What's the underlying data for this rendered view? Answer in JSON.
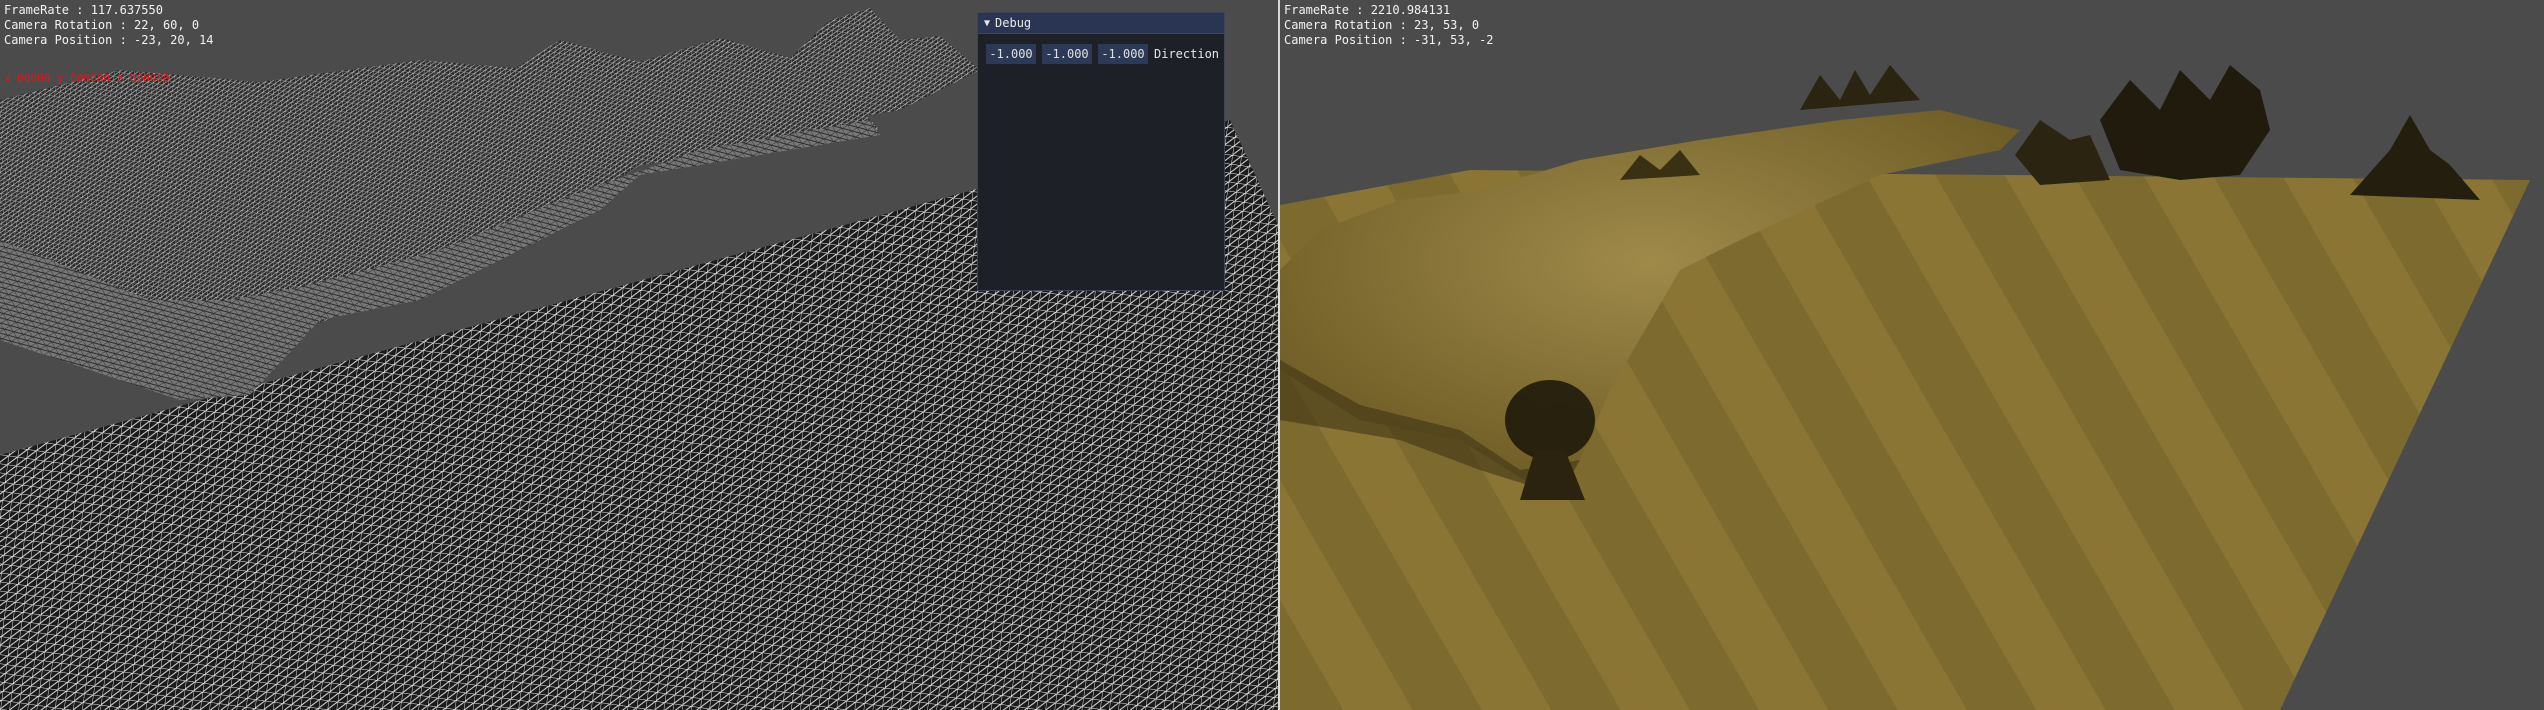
{
  "left_view": {
    "hud": {
      "framerate": "FrameRate : 117.637550",
      "camera_rotation": "Camera Rotation : 22, 60, 0",
      "camera_position": "Camera Position : -23, 20, 14"
    },
    "red_overlay": "x 00000  y 000000  z 000000",
    "render_mode": "wireframe"
  },
  "debug_window": {
    "title": "Debug",
    "fields": [
      "-1.000",
      "-1.000",
      "-1.000"
    ],
    "label": "Direction"
  },
  "right_view": {
    "hud": {
      "framerate": "FrameRate : 2210.984131",
      "camera_rotation": "Camera Rotation : 23, 53, 0",
      "camera_position": "Camera Position : -31, 53, -2"
    },
    "render_mode": "textured"
  },
  "colors": {
    "background": "#4b4b4b",
    "wire": "#ffffff",
    "terrain": "#8c7636",
    "imgui_bg": "#1e2028",
    "imgui_title": "#293553",
    "imgui_field": "#2c3a57",
    "hud_text": "#f2f2f2",
    "warn_text": "#e01818"
  }
}
